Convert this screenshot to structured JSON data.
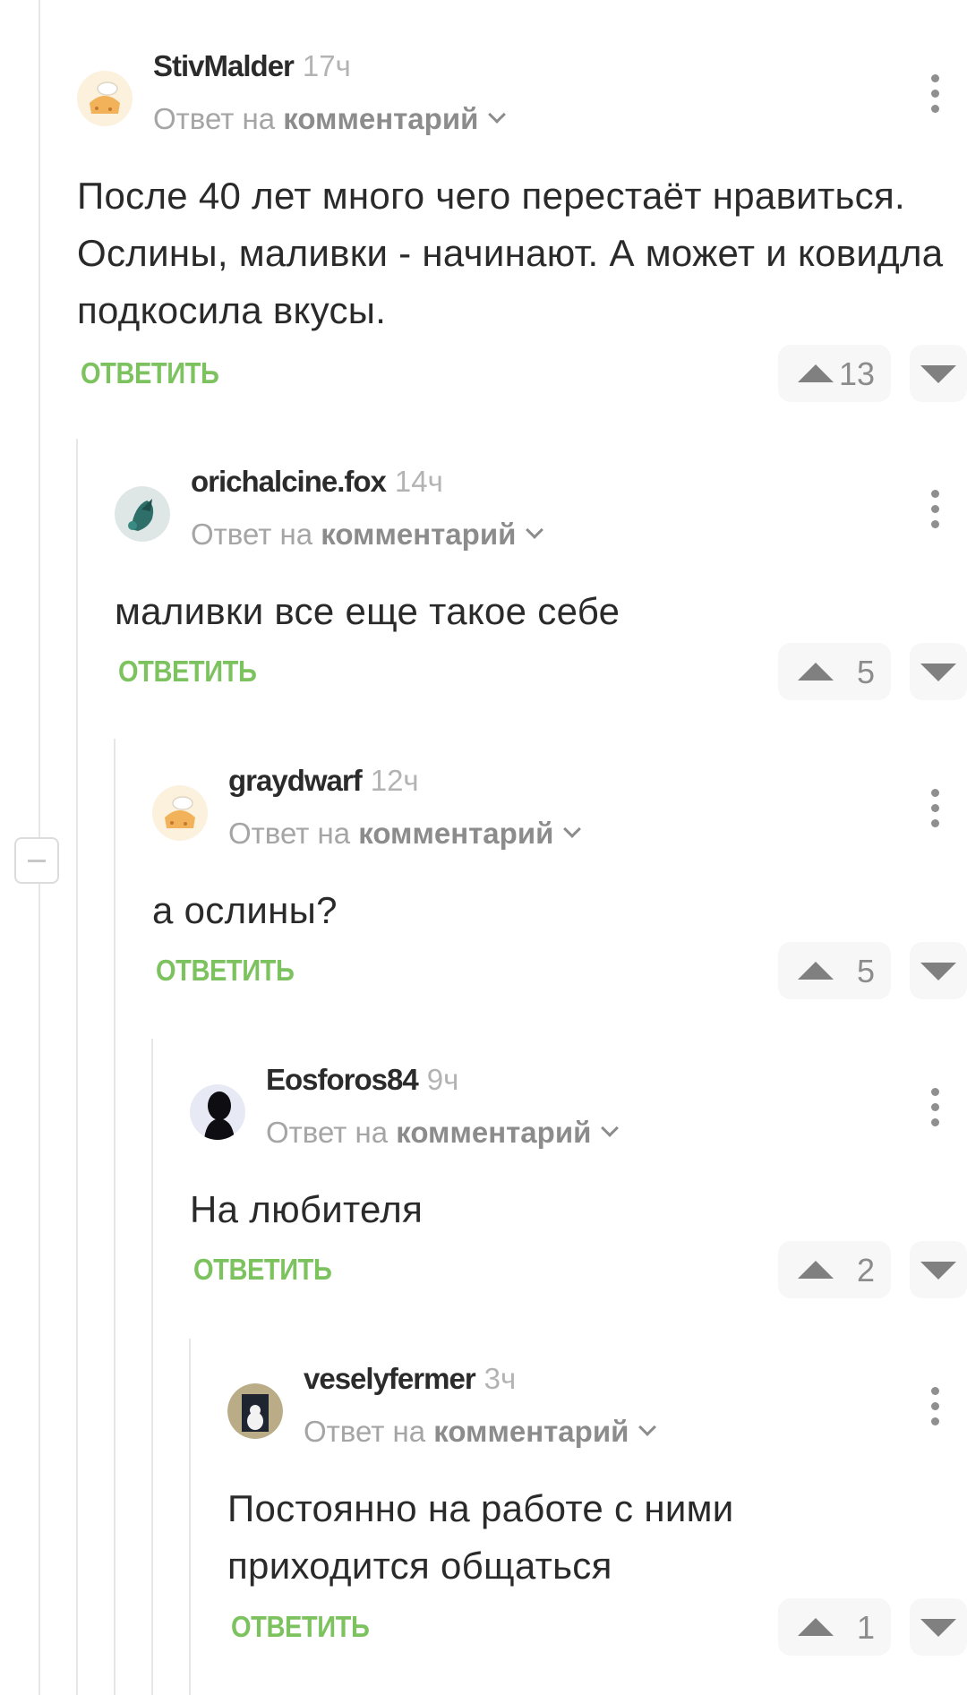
{
  "comments": [
    {
      "author": "StivMalder",
      "time": "17ч",
      "reply_prefix": "Ответ на",
      "reply_target": "комментарий",
      "text": "После 40 лет много чего перестаёт нравиться. Ослины, маливки - начинают. А может и ковидла подкосила вкусы.",
      "reply_label": "ОТВЕТИТЬ",
      "rating": "13",
      "avatar": "muffin-avatar"
    },
    {
      "author": "orichalcine.fox",
      "time": "14ч",
      "reply_prefix": "Ответ на",
      "reply_target": "комментарий",
      "text": "маливки все еще такое себе",
      "reply_label": "ОТВЕТИТЬ",
      "rating": "5",
      "avatar": "fox-avatar"
    },
    {
      "author": "graydwarf",
      "time": "12ч",
      "reply_prefix": "Ответ на",
      "reply_target": "комментарий",
      "text": "а ослины?",
      "reply_label": "ОТВЕТИТЬ",
      "rating": "5",
      "avatar": "muffin-avatar"
    },
    {
      "author": "Eosforos84",
      "time": "9ч",
      "reply_prefix": "Ответ на",
      "reply_target": "комментарий",
      "text": "На любителя",
      "reply_label": "ОТВЕТИТЬ",
      "rating": "2",
      "avatar": "silhouette-avatar"
    },
    {
      "author": "veselyfermer",
      "time": "3ч",
      "reply_prefix": "Ответ на",
      "reply_target": "комментарий",
      "text": "Постоянно на работе с ними приходится общаться",
      "reply_label": "ОТВЕТИТЬ",
      "rating": "1",
      "avatar": "dog-avatar"
    }
  ],
  "colors": {
    "accent_green": "#7cc25e",
    "meta_gray": "#a5a5a5"
  }
}
